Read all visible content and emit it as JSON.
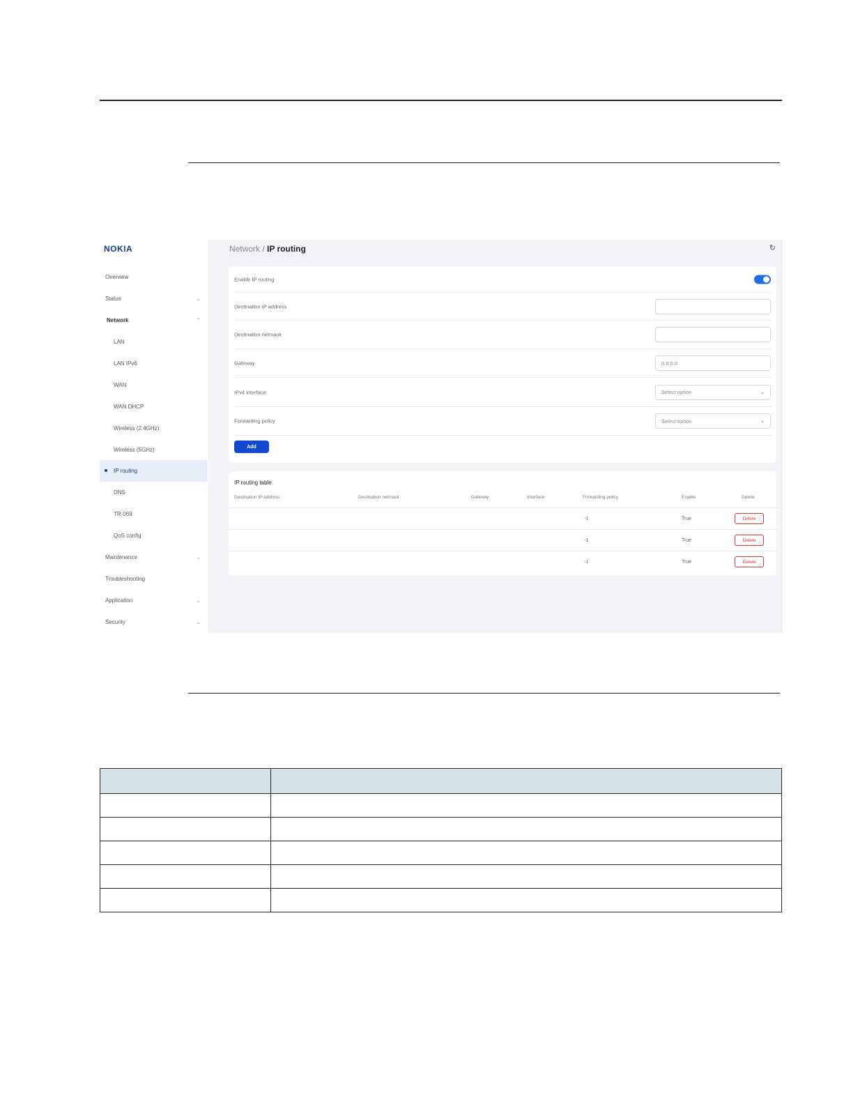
{
  "app": {
    "logo": "NOKIA"
  },
  "breadcrumb": {
    "parent": "Network /",
    "current": "IP routing"
  },
  "sidebar": {
    "items": [
      {
        "label": "Overview",
        "chevron": ""
      },
      {
        "label": "Status",
        "chevron": "⌄"
      },
      {
        "label": "Network",
        "chevron": "⌃"
      },
      {
        "label": "LAN",
        "chevron": ""
      },
      {
        "label": "LAN IPv6",
        "chevron": ""
      },
      {
        "label": "WAN",
        "chevron": ""
      },
      {
        "label": "WAN DHCP",
        "chevron": ""
      },
      {
        "label": "Wireless (2.4GHz)",
        "chevron": ""
      },
      {
        "label": "Wireless (5GHz)",
        "chevron": ""
      },
      {
        "label": "IP routing",
        "chevron": ""
      },
      {
        "label": "DNS",
        "chevron": ""
      },
      {
        "label": "TR-069",
        "chevron": ""
      },
      {
        "label": "QoS config",
        "chevron": ""
      },
      {
        "label": "Maintenance",
        "chevron": "⌄"
      },
      {
        "label": "Troubleshooting",
        "chevron": ""
      },
      {
        "label": "Application",
        "chevron": "⌄"
      },
      {
        "label": "Security",
        "chevron": "⌄"
      }
    ]
  },
  "form": {
    "enable_label": "Enable IP routing",
    "enable_on": true,
    "dest_ip_label": "Destination IP address",
    "dest_ip_value": "",
    "dest_mask_label": "Destination netmask",
    "dest_mask_value": "",
    "gateway_label": "Gateway",
    "gateway_value": "0.0.0.0",
    "iface_label": "IPv4 interface",
    "iface_value": "Select option",
    "policy_label": "Forwarding policy",
    "policy_value": "Select option",
    "add_label": "Add"
  },
  "routing_table": {
    "title": "IP routing table",
    "headers": [
      "Destination IP address",
      "Destination netmask",
      "Gateway",
      "Interface",
      "Forwarding policy",
      "Enable",
      "Delete"
    ],
    "rows": [
      {
        "policy": "-1",
        "enable": "True",
        "delete": "Delete"
      },
      {
        "policy": "-1",
        "enable": "True",
        "delete": "Delete"
      },
      {
        "policy": "-1",
        "enable": "True",
        "delete": "Delete"
      }
    ]
  },
  "icons": {
    "refresh": "refresh-icon",
    "chevron": "chevron-icon",
    "select_arrow": "chevron-down-icon"
  },
  "colors": {
    "brand": "#124191",
    "accent": "#1f6ee0",
    "danger": "#dd3333",
    "table_header": "#d3e2e9"
  }
}
